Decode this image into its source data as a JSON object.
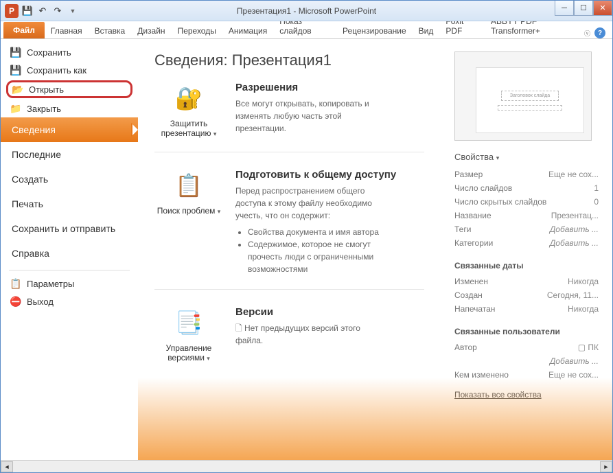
{
  "title": "Презентация1 - Microsoft PowerPoint",
  "tabs": {
    "file": "Файл",
    "home": "Главная",
    "insert": "Вставка",
    "design": "Дизайн",
    "transitions": "Переходы",
    "animation": "Анимация",
    "slideshow": "Показ слайдов",
    "review": "Рецензирование",
    "view": "Вид",
    "foxit": "Foxit PDF",
    "abbyy": "ABBYY PDF Transformer+"
  },
  "sidebar": {
    "save": "Сохранить",
    "saveas": "Сохранить как",
    "open": "Открыть",
    "close": "Закрыть",
    "info": "Сведения",
    "recent": "Последние",
    "new": "Создать",
    "print": "Печать",
    "share": "Сохранить и отправить",
    "help": "Справка",
    "options": "Параметры",
    "exit": "Выход"
  },
  "main": {
    "title": "Сведения: Презентация1",
    "protect": {
      "btn": "Защитить презентацию",
      "head": "Разрешения",
      "text": "Все могут открывать, копировать и изменять любую часть этой презентации."
    },
    "prepare": {
      "btn": "Поиск проблем",
      "head": "Подготовить к общему доступу",
      "text": "Перед распространением общего доступа к этому файлу необходимо учесть, что он содержит:",
      "li1": "Свойства документа и имя автора",
      "li2": "Содержимое, которое не смогут прочесть люди с ограниченными возможностями"
    },
    "versions": {
      "btn": "Управление версиями",
      "head": "Версии",
      "text": "Нет предыдущих версий этого файла."
    }
  },
  "thumb": {
    "title": "Заголовок слайда"
  },
  "props": {
    "head": "Свойства",
    "size_l": "Размер",
    "size_v": "Еще не сох...",
    "slides_l": "Число слайдов",
    "slides_v": "1",
    "hidden_l": "Число скрытых слайдов",
    "hidden_v": "0",
    "name_l": "Название",
    "name_v": "Презентац...",
    "tags_l": "Теги",
    "tags_v": "Добавить ...",
    "cat_l": "Категории",
    "cat_v": "Добавить ...",
    "dates_head": "Связанные даты",
    "modified_l": "Изменен",
    "modified_v": "Никогда",
    "created_l": "Создан",
    "created_v": "Сегодня, 11...",
    "printed_l": "Напечатан",
    "printed_v": "Никогда",
    "users_head": "Связанные пользователи",
    "author_l": "Автор",
    "author_v": "ПК",
    "author_add": "Добавить ...",
    "changedby_l": "Кем изменено",
    "changedby_v": "Еще не сох...",
    "showall": "Показать все свойства"
  }
}
